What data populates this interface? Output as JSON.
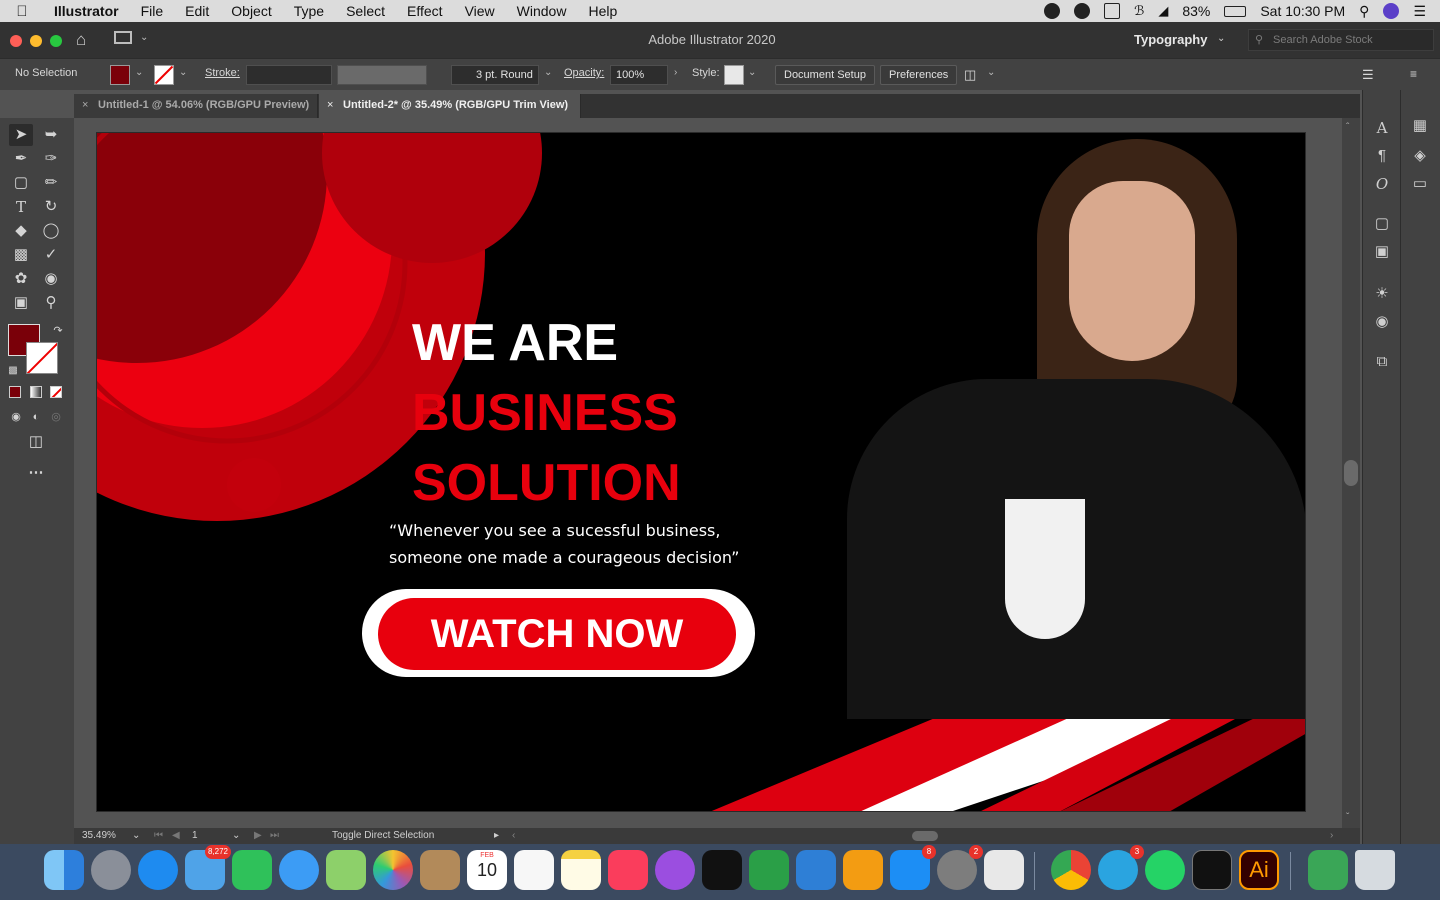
{
  "menubar": {
    "app_name": "Illustrator",
    "menus": [
      "File",
      "Edit",
      "Object",
      "Type",
      "Select",
      "Effect",
      "View",
      "Window",
      "Help"
    ],
    "battery": "83%",
    "clock": "Sat 10:30 PM"
  },
  "titlebar": {
    "title": "Adobe Illustrator 2020",
    "workspace": "Typography",
    "stock_placeholder": "Search Adobe Stock"
  },
  "controlbar": {
    "selection": "No Selection",
    "stroke_label": "Stroke:",
    "brush": "3 pt. Round",
    "opacity_label": "Opacity:",
    "opacity_value": "100%",
    "style_label": "Style:",
    "document_setup": "Document Setup",
    "preferences": "Preferences",
    "fill_color": "#7a0009"
  },
  "tabs": [
    {
      "label": "Untitled-1 @ 54.06% (RGB/GPU Preview)"
    },
    {
      "label": "Untitled-2* @ 35.49% (RGB/GPU Trim View)"
    }
  ],
  "artboard": {
    "line1": "WE ARE",
    "line2": "BUSINESS",
    "line3": "SOLUTION",
    "quote_line1": "“Whenever you see a sucessful business,",
    "quote_line2": "someone one made a courageous decision”",
    "cta": "WATCH NOW",
    "accent": "#e8000d"
  },
  "status": {
    "zoom": "35.49%",
    "page": "1",
    "hint": "Toggle Direct Selection"
  },
  "dock": {
    "badges": {
      "mail": "8,272",
      "appstore": "8",
      "prefs": "2",
      "telegram": "3"
    },
    "calendar_month": "FEB",
    "calendar_day": "10",
    "illustrator": "Ai"
  }
}
